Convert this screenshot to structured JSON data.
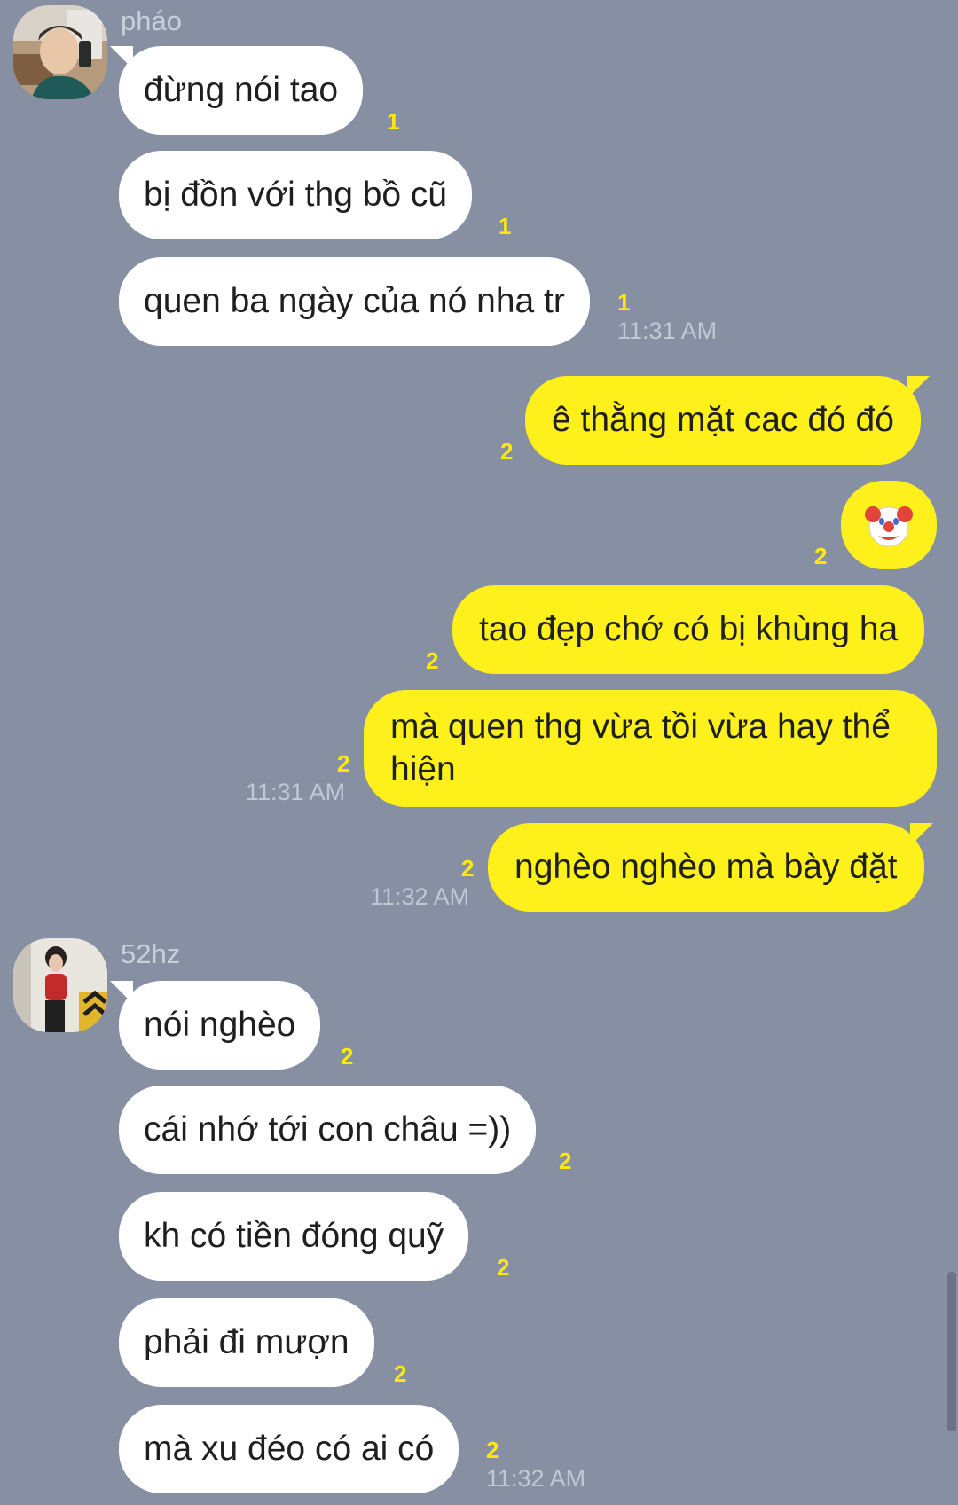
{
  "accent_colors": {
    "background": "#8790a3",
    "incoming_bubble": "#ffffff",
    "outgoing_bubble": "#fef01b",
    "unread_count": "#fde910"
  },
  "chat": {
    "sender1": {
      "name": "pháo",
      "avatar": "avatar-photo"
    },
    "sender2": {
      "name": "52hz",
      "avatar": "avatar-photo"
    },
    "messages": [
      {
        "text": "đừng nói tao",
        "unread": "1"
      },
      {
        "text": "bị đồn với thg bồ cũ",
        "unread": "1"
      },
      {
        "text": "quen ba ngày của nó nha tr",
        "unread": "1",
        "time": "11:31 AM"
      },
      {
        "text": "ê thằng mặt cac đó đó",
        "unread": "2"
      },
      {
        "text": "",
        "unread": "2",
        "emoji": "clown-face-emoji"
      },
      {
        "text": "tao đẹp chớ có bị khùng ha",
        "unread": "2"
      },
      {
        "text": "mà quen thg vừa tồi vừa hay thể hiện",
        "unread": "2",
        "time": "11:31 AM"
      },
      {
        "text": "nghèo nghèo mà bày đặt",
        "unread": "2",
        "time": "11:32 AM"
      },
      {
        "text": "nói nghèo",
        "unread": "2"
      },
      {
        "text": "cái nhớ tới con châu =))",
        "unread": "2"
      },
      {
        "text": "kh có tiền đóng quỹ",
        "unread": "2"
      },
      {
        "text": "phải đi mượn",
        "unread": "2"
      },
      {
        "text": "mà xu đéo có ai có",
        "unread": "2",
        "time": "11:32 AM"
      }
    ]
  }
}
